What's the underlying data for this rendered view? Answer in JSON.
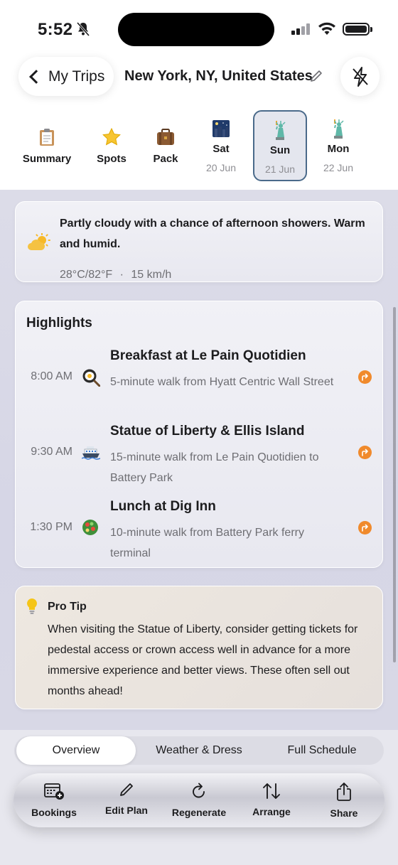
{
  "status_bar": {
    "time": "5:52"
  },
  "header": {
    "back_label": "My Trips",
    "trip_title": "New York, NY, United States"
  },
  "tabs": [
    {
      "label": "Summary",
      "icon": "clipboard-icon"
    },
    {
      "label": "Spots",
      "icon": "star-icon"
    },
    {
      "label": "Pack",
      "icon": "suitcase-icon"
    },
    {
      "label": "Sat",
      "date": "20 Jun",
      "icon": "night-city-icon"
    },
    {
      "label": "Sun",
      "date": "21 Jun",
      "icon": "statue-of-liberty-icon",
      "selected": true
    },
    {
      "label": "Mon",
      "date": "22 Jun",
      "icon": "statue-of-liberty-icon"
    }
  ],
  "weather": {
    "description": "Partly cloudy with a chance of afternoon showers. Warm and humid.",
    "temperature": "28°C/82°F",
    "separator": "·",
    "wind": "15 km/h"
  },
  "highlights": {
    "title": "Highlights",
    "items": [
      {
        "time": "8:00 AM",
        "name": "Breakfast at Le Pain Quotidien",
        "walk": "5-minute walk from Hyatt Centric Wall Street",
        "icon": "frying-pan-egg-icon"
      },
      {
        "time": "9:30 AM",
        "name": "Statue of Liberty & Ellis Island",
        "walk": "15-minute walk from Le Pain Quotidien to Battery Park",
        "icon": "ferry-icon"
      },
      {
        "time": "1:30 PM",
        "name": "Lunch at Dig Inn",
        "walk": "10-minute walk from Battery Park ferry terminal",
        "icon": "salad-icon"
      }
    ]
  },
  "pro_tip": {
    "title": "Pro Tip",
    "text": "When visiting the Statue of Liberty, consider getting tickets for pedestal access or crown access well in advance for a more immersive experience and better views. These often sell out months ahead!"
  },
  "segments": [
    {
      "label": "Overview",
      "active": true
    },
    {
      "label": "Weather & Dress"
    },
    {
      "label": "Full Schedule"
    }
  ],
  "toolbar": {
    "items": [
      {
        "label": "Bookings",
        "icon": "calendar-add-icon"
      },
      {
        "label": "Edit Plan",
        "icon": "pencil-icon"
      },
      {
        "label": "Regenerate",
        "icon": "refresh-icon"
      },
      {
        "label": "Arrange",
        "icon": "sort-arrows-icon"
      },
      {
        "label": "Share",
        "icon": "share-icon"
      }
    ]
  },
  "colors": {
    "accent_orange": "#f08a2c",
    "selected_border": "#4a6a8a",
    "tip_bulb": "#f5c518"
  }
}
